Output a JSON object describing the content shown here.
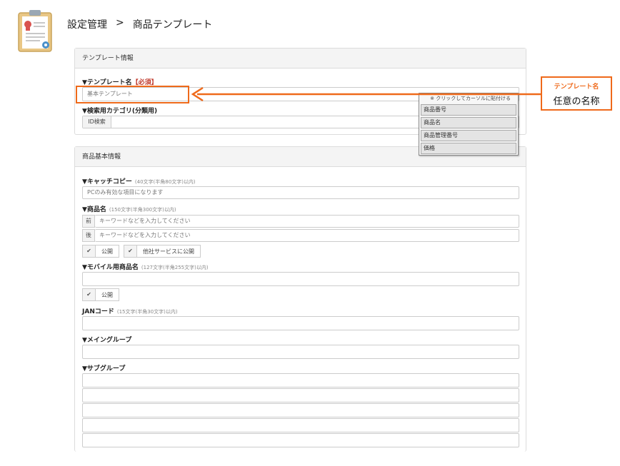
{
  "breadcrumb": {
    "parent": "設定管理",
    "separator": ">",
    "current": "商品テンプレート"
  },
  "template_panel": {
    "heading": "テンプレート情報",
    "name_label": "▼テンプレート名",
    "name_required": "【必須】",
    "name_value": "基本テンプレート",
    "category_label": "▼検索用カテゴリ(分類用)",
    "id_search_label": "ID検索"
  },
  "popup": {
    "title": "※ クリックしてカーソルに貼付ける",
    "items": [
      "商品番号",
      "商品名",
      "商品管理番号",
      "価格"
    ]
  },
  "callout": {
    "title": "テンプレート名",
    "body": "任意の名称"
  },
  "basic_panel": {
    "heading": "商品基本情報",
    "catch_label": "▼キャッチコピー",
    "catch_note": "(40文字(半角80文字)以内)",
    "catch_placeholder": "PCのみ有効な項目になります",
    "product_label": "▼商品名",
    "product_note": "(150文字(半角300文字)以内)",
    "prefix_front": "前",
    "prefix_back": "後",
    "keyword_placeholder": "キーワードなどを入力してください",
    "public_label": "公開",
    "other_service_label": "他社サービスに公開",
    "check_mark": "✔",
    "mobile_label": "▼モバイル用商品名",
    "mobile_note": "(127文字(半角255文字)以内)",
    "jan_label": "JANコード",
    "jan_note": "(15文字(半角30文字)以内)",
    "main_group_label": "▼メイングループ",
    "sub_group_label": "▼サブグループ"
  }
}
